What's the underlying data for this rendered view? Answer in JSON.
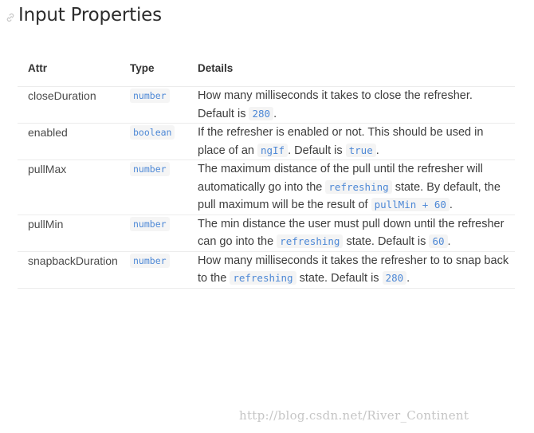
{
  "heading": {
    "title": "Input Properties",
    "icon": "link-icon"
  },
  "table": {
    "headers": {
      "attr": "Attr",
      "type": "Type",
      "details": "Details"
    },
    "rows": [
      {
        "attr": "closeDuration",
        "type": "number",
        "details": [
          {
            "t": "How many milliseconds it takes to close the refresher. Default is "
          },
          {
            "c": "280"
          },
          {
            "t": "."
          }
        ]
      },
      {
        "attr": "enabled",
        "type": "boolean",
        "details": [
          {
            "t": "If the refresher is enabled or not. This should be used in place of an "
          },
          {
            "c": "ngIf"
          },
          {
            "t": ". Default is "
          },
          {
            "c": "true"
          },
          {
            "t": "."
          }
        ]
      },
      {
        "attr": "pullMax",
        "type": "number",
        "details": [
          {
            "t": "The maximum distance of the pull until the refresher will automatically go into the "
          },
          {
            "c": "refreshing"
          },
          {
            "t": " state. By default, the pull maximum will be the result of "
          },
          {
            "c": "pullMin + 60"
          },
          {
            "t": "."
          }
        ]
      },
      {
        "attr": "pullMin",
        "type": "number",
        "details": [
          {
            "t": "The min distance the user must pull down until the refresher can go into the "
          },
          {
            "c": "refreshing"
          },
          {
            "t": " state. Default is "
          },
          {
            "c": "60"
          },
          {
            "t": "."
          }
        ]
      },
      {
        "attr": "snapbackDuration",
        "type": "number",
        "details": [
          {
            "t": "How many milliseconds it takes the refresher to to snap back to the "
          },
          {
            "c": "refreshing"
          },
          {
            "t": " state. Default is "
          },
          {
            "c": "280"
          },
          {
            "t": "."
          }
        ]
      }
    ]
  },
  "watermark": "http://blog.csdn.net/River_Continent"
}
